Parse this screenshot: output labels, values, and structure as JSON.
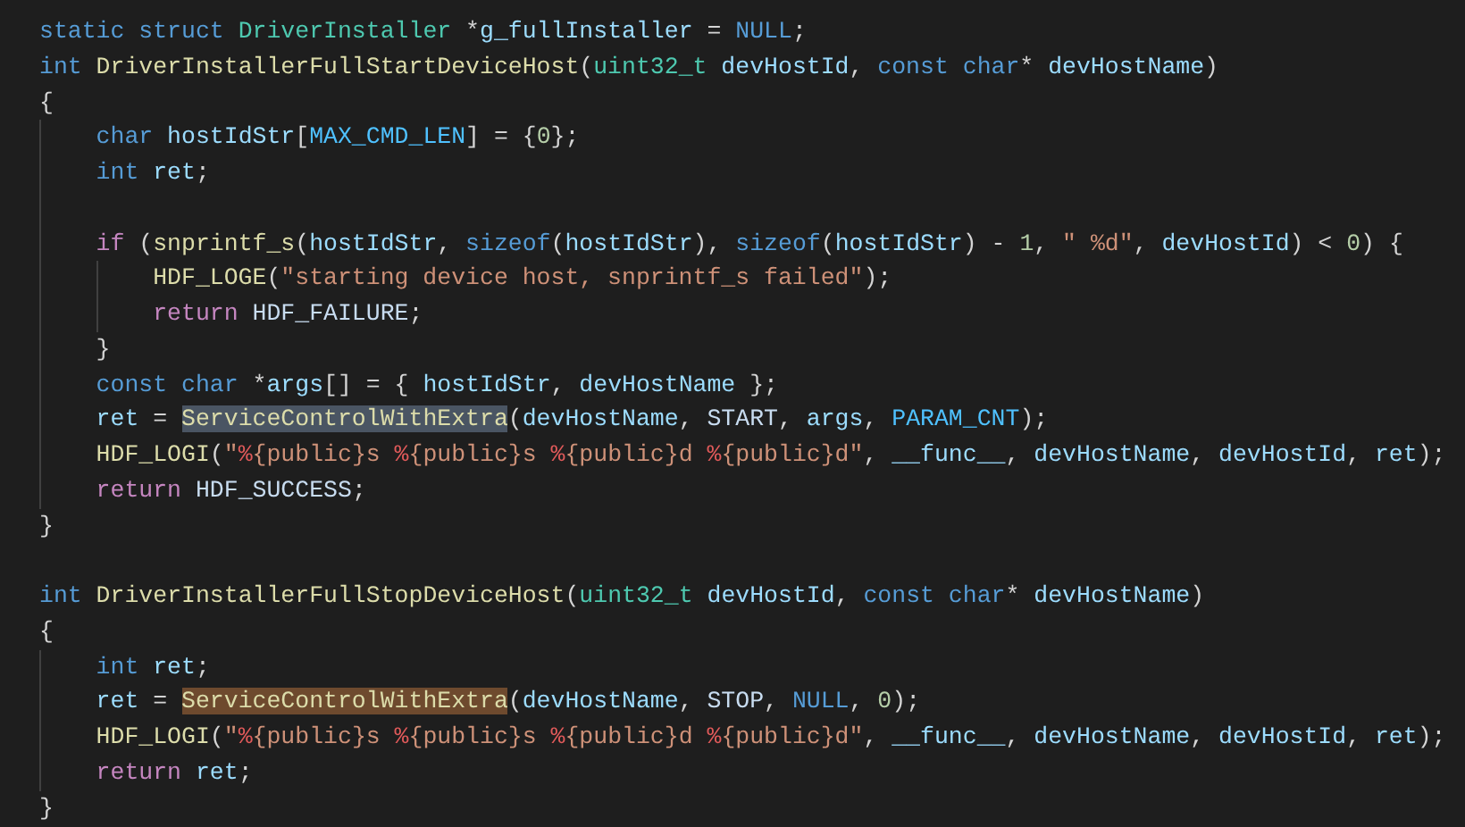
{
  "editor": {
    "lines": [
      {
        "kind": "code",
        "tokens": [
          {
            "text": "static struct",
            "kind": "kw"
          },
          {
            "text": " DriverInstaller",
            "kind": "type"
          },
          {
            "text": " *",
            "kind": "plain"
          },
          {
            "text": "g_fullInstaller",
            "kind": "var"
          },
          {
            "text": " = ",
            "kind": "plain"
          },
          {
            "text": "NULL",
            "kind": "kw"
          },
          {
            "text": ";",
            "kind": "plain"
          }
        ]
      },
      {
        "kind": "code",
        "tokens": [
          {
            "text": "int",
            "kind": "kw"
          },
          {
            "text": " DriverInstallerFullStartDeviceHost",
            "kind": "fn"
          },
          {
            "text": "(",
            "kind": "plain"
          },
          {
            "text": "uint32_t",
            "kind": "type"
          },
          {
            "text": " devHostId",
            "kind": "var"
          },
          {
            "text": ", ",
            "kind": "plain"
          },
          {
            "text": "const char",
            "kind": "kw"
          },
          {
            "text": "* ",
            "kind": "plain"
          },
          {
            "text": "devHostName",
            "kind": "var"
          },
          {
            "text": ")",
            "kind": "plain"
          }
        ]
      },
      {
        "kind": "code",
        "tokens": [
          {
            "text": "{",
            "kind": "plain"
          }
        ],
        "children": [
          {
            "kind": "code",
            "tokens": [
              {
                "text": "char",
                "kind": "kw"
              },
              {
                "text": " hostIdStr",
                "kind": "var"
              },
              {
                "text": "[",
                "kind": "plain"
              },
              {
                "text": "MAX_CMD_LEN",
                "kind": "const"
              },
              {
                "text": "] = {",
                "kind": "plain"
              },
              {
                "text": "0",
                "kind": "num"
              },
              {
                "text": "};",
                "kind": "plain"
              }
            ]
          },
          {
            "kind": "code",
            "tokens": [
              {
                "text": "int",
                "kind": "kw"
              },
              {
                "text": " ret",
                "kind": "var"
              },
              {
                "text": ";",
                "kind": "plain"
              }
            ]
          },
          {
            "kind": "blank"
          },
          {
            "kind": "code",
            "tokens": [
              {
                "text": "if",
                "kind": "ctl"
              },
              {
                "text": " (",
                "kind": "plain"
              },
              {
                "text": "snprintf_s",
                "kind": "fn"
              },
              {
                "text": "(",
                "kind": "plain"
              },
              {
                "text": "hostIdStr",
                "kind": "var"
              },
              {
                "text": ", ",
                "kind": "plain"
              },
              {
                "text": "sizeof",
                "kind": "kw"
              },
              {
                "text": "(",
                "kind": "plain"
              },
              {
                "text": "hostIdStr",
                "kind": "var"
              },
              {
                "text": "), ",
                "kind": "plain"
              },
              {
                "text": "sizeof",
                "kind": "kw"
              },
              {
                "text": "(",
                "kind": "plain"
              },
              {
                "text": "hostIdStr",
                "kind": "var"
              },
              {
                "text": ") - ",
                "kind": "plain"
              },
              {
                "text": "1",
                "kind": "num"
              },
              {
                "text": ", ",
                "kind": "plain"
              },
              {
                "text": "\" %d\"",
                "kind": "str"
              },
              {
                "text": ", ",
                "kind": "plain"
              },
              {
                "text": "devHostId",
                "kind": "var"
              },
              {
                "text": ") < ",
                "kind": "plain"
              },
              {
                "text": "0",
                "kind": "num"
              },
              {
                "text": ") {",
                "kind": "plain"
              }
            ],
            "children": [
              {
                "kind": "code",
                "tokens": [
                  {
                    "text": "HDF_LOGE",
                    "kind": "fn"
                  },
                  {
                    "text": "(",
                    "kind": "plain"
                  },
                  {
                    "text": "\"starting device host, snprintf_s failed\"",
                    "kind": "str"
                  },
                  {
                    "text": ");",
                    "kind": "plain"
                  }
                ]
              },
              {
                "kind": "code",
                "tokens": [
                  {
                    "text": "return",
                    "kind": "ctl"
                  },
                  {
                    "text": " HDF_FAILURE",
                    "kind": "macro"
                  },
                  {
                    "text": ";",
                    "kind": "plain"
                  }
                ]
              }
            ]
          },
          {
            "kind": "code",
            "tokens": [
              {
                "text": "}",
                "kind": "plain"
              }
            ]
          },
          {
            "kind": "code",
            "tokens": [
              {
                "text": "const char",
                "kind": "kw"
              },
              {
                "text": " *",
                "kind": "plain"
              },
              {
                "text": "args",
                "kind": "var"
              },
              {
                "text": "[] = { ",
                "kind": "plain"
              },
              {
                "text": "hostIdStr",
                "kind": "var"
              },
              {
                "text": ", ",
                "kind": "plain"
              },
              {
                "text": "devHostName",
                "kind": "var"
              },
              {
                "text": " };",
                "kind": "plain"
              }
            ]
          },
          {
            "kind": "code",
            "tokens": [
              {
                "text": "ret",
                "kind": "var"
              },
              {
                "text": " = ",
                "kind": "plain"
              },
              {
                "text": "ServiceControlWithExtra",
                "kind": "fn",
                "highlighted": true,
                "write": false
              },
              {
                "text": "(",
                "kind": "plain"
              },
              {
                "text": "devHostName",
                "kind": "var"
              },
              {
                "text": ", ",
                "kind": "plain"
              },
              {
                "text": "START",
                "kind": "macro"
              },
              {
                "text": ", ",
                "kind": "plain"
              },
              {
                "text": "args",
                "kind": "var"
              },
              {
                "text": ", ",
                "kind": "plain"
              },
              {
                "text": "PARAM_CNT",
                "kind": "const"
              },
              {
                "text": ");",
                "kind": "plain"
              }
            ]
          },
          {
            "kind": "code",
            "tokens": [
              {
                "text": "HDF_LOGI",
                "kind": "fn"
              },
              {
                "text": "(",
                "kind": "plain"
              },
              {
                "text": "\"",
                "kind": "str"
              },
              {
                "text": "%",
                "kind": "fmt"
              },
              {
                "text": "{public}s ",
                "kind": "str"
              },
              {
                "text": "%",
                "kind": "fmt"
              },
              {
                "text": "{public}s ",
                "kind": "str"
              },
              {
                "text": "%",
                "kind": "fmt"
              },
              {
                "text": "{public}d ",
                "kind": "str"
              },
              {
                "text": "%",
                "kind": "fmt"
              },
              {
                "text": "{public}d\"",
                "kind": "str"
              },
              {
                "text": ", ",
                "kind": "plain"
              },
              {
                "text": "__func__",
                "kind": "var"
              },
              {
                "text": ", ",
                "kind": "plain"
              },
              {
                "text": "devHostName",
                "kind": "var"
              },
              {
                "text": ", ",
                "kind": "plain"
              },
              {
                "text": "devHostId",
                "kind": "var"
              },
              {
                "text": ", ",
                "kind": "plain"
              },
              {
                "text": "ret",
                "kind": "var"
              },
              {
                "text": ");",
                "kind": "plain"
              }
            ]
          },
          {
            "kind": "code",
            "tokens": [
              {
                "text": "return",
                "kind": "ctl"
              },
              {
                "text": " HDF_SUCCESS",
                "kind": "macro"
              },
              {
                "text": ";",
                "kind": "plain"
              }
            ]
          }
        ]
      },
      {
        "kind": "code",
        "tokens": [
          {
            "text": "}",
            "kind": "plain"
          }
        ]
      },
      {
        "kind": "blank"
      },
      {
        "kind": "code",
        "tokens": [
          {
            "text": "int",
            "kind": "kw"
          },
          {
            "text": " DriverInstallerFullStopDeviceHost",
            "kind": "fn"
          },
          {
            "text": "(",
            "kind": "plain"
          },
          {
            "text": "uint32_t",
            "kind": "type"
          },
          {
            "text": " devHostId",
            "kind": "var"
          },
          {
            "text": ", ",
            "kind": "plain"
          },
          {
            "text": "const char",
            "kind": "kw"
          },
          {
            "text": "* ",
            "kind": "plain"
          },
          {
            "text": "devHostName",
            "kind": "var"
          },
          {
            "text": ")",
            "kind": "plain"
          }
        ]
      },
      {
        "kind": "code",
        "tokens": [
          {
            "text": "{",
            "kind": "plain"
          }
        ],
        "children": [
          {
            "kind": "code",
            "tokens": [
              {
                "text": "int",
                "kind": "kw"
              },
              {
                "text": " ret",
                "kind": "var"
              },
              {
                "text": ";",
                "kind": "plain"
              }
            ]
          },
          {
            "kind": "code",
            "tokens": [
              {
                "text": "ret",
                "kind": "var"
              },
              {
                "text": " = ",
                "kind": "plain"
              },
              {
                "text": "ServiceControlWithExtra",
                "kind": "fn",
                "highlighted": true,
                "write": true
              },
              {
                "text": "(",
                "kind": "plain"
              },
              {
                "text": "devHostName",
                "kind": "var"
              },
              {
                "text": ", ",
                "kind": "plain"
              },
              {
                "text": "STOP",
                "kind": "macro"
              },
              {
                "text": ", ",
                "kind": "plain"
              },
              {
                "text": "NULL",
                "kind": "kw"
              },
              {
                "text": ", ",
                "kind": "plain"
              },
              {
                "text": "0",
                "kind": "num"
              },
              {
                "text": ");",
                "kind": "plain"
              }
            ]
          },
          {
            "kind": "code",
            "tokens": [
              {
                "text": "HDF_LOGI",
                "kind": "fn"
              },
              {
                "text": "(",
                "kind": "plain"
              },
              {
                "text": "\"",
                "kind": "str"
              },
              {
                "text": "%",
                "kind": "fmt"
              },
              {
                "text": "{public}s ",
                "kind": "str"
              },
              {
                "text": "%",
                "kind": "fmt"
              },
              {
                "text": "{public}s ",
                "kind": "str"
              },
              {
                "text": "%",
                "kind": "fmt"
              },
              {
                "text": "{public}d ",
                "kind": "str"
              },
              {
                "text": "%",
                "kind": "fmt"
              },
              {
                "text": "{public}d\"",
                "kind": "str"
              },
              {
                "text": ", ",
                "kind": "plain"
              },
              {
                "text": "__func__",
                "kind": "var"
              },
              {
                "text": ", ",
                "kind": "plain"
              },
              {
                "text": "devHostName",
                "kind": "var"
              },
              {
                "text": ", ",
                "kind": "plain"
              },
              {
                "text": "devHostId",
                "kind": "var"
              },
              {
                "text": ", ",
                "kind": "plain"
              },
              {
                "text": "ret",
                "kind": "var"
              },
              {
                "text": ");",
                "kind": "plain"
              }
            ]
          },
          {
            "kind": "code",
            "tokens": [
              {
                "text": "return",
                "kind": "ctl"
              },
              {
                "text": " ret",
                "kind": "var"
              },
              {
                "text": ";",
                "kind": "plain"
              }
            ]
          }
        ]
      },
      {
        "kind": "code",
        "tokens": [
          {
            "text": "}",
            "kind": "plain"
          }
        ]
      }
    ]
  }
}
